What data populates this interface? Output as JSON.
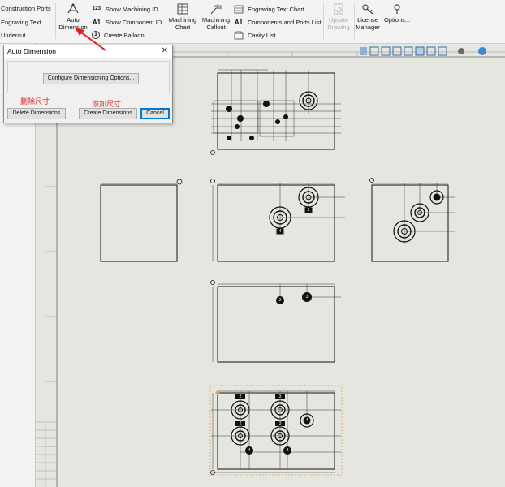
{
  "ribbon": {
    "left_items": [
      "Construction Ports",
      "Engraving Text",
      "Undercut"
    ],
    "auto_dimension": [
      "Auto",
      "Dimension"
    ],
    "small_items": [
      "Show Machining ID",
      "Show Component ID",
      "Create Balloon"
    ],
    "machining_chart": [
      "Machining",
      "Chart"
    ],
    "machining_callout": [
      "Machining",
      "Callout"
    ],
    "right_items": [
      "Engraving Text Chart",
      "Components and Ports List",
      "Cavity List"
    ],
    "update_drawing": [
      "Update",
      "Drawing"
    ],
    "license_manager": [
      "License",
      "Manager"
    ],
    "options": "Options..."
  },
  "dialog": {
    "title": "Auto Dimension",
    "configure_button": "Configure Dimensioning Options...",
    "delete_button": "Delete Dimensions",
    "create_button": "Create Dimensions",
    "cancel_button": "Cancel"
  },
  "annotations": {
    "delete": "删除尺寸",
    "create": "添加尺寸"
  },
  "balloons": [
    "2",
    "4",
    "2",
    "3",
    "4",
    "3",
    "2",
    "3",
    "2",
    "3",
    "4"
  ],
  "icon_names": [
    "auto-dimension-icon",
    "machining-chart-icon",
    "machining-callout-icon",
    "engraving-text-chart-icon",
    "components-ports-list-icon",
    "cavity-list-icon",
    "update-drawing-icon",
    "license-manager-icon",
    "options-icon"
  ],
  "colors": {
    "annotation_red": "#e02020",
    "selection_orange": "#e8a040",
    "accent_blue": "#0078d7"
  }
}
